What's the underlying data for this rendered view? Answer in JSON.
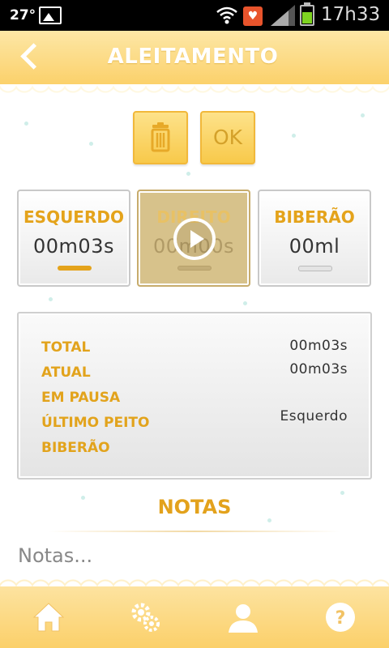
{
  "status_bar": {
    "temperature": "27°",
    "time": "17h33"
  },
  "header": {
    "title": "ALEITAMENTO"
  },
  "actions": {
    "ok_label": "OK"
  },
  "breasts": {
    "left": {
      "label": "ESQUERDO",
      "value": "00m03s"
    },
    "right": {
      "label": "DIREITO",
      "value": "00m00s"
    },
    "bottle": {
      "label": "BIBERÃO",
      "value": "00ml"
    }
  },
  "summary": {
    "rows": [
      {
        "label": "TOTAL",
        "value": "00m03s"
      },
      {
        "label": "ATUAL",
        "value": "00m03s"
      },
      {
        "label": "EM PAUSA",
        "value": ""
      },
      {
        "label": "ÚLTIMO PEITO",
        "value": "Esquerdo"
      },
      {
        "label": "BIBERÃO",
        "value": ""
      }
    ]
  },
  "notes": {
    "title": "NOTAS",
    "placeholder": "Notas..."
  },
  "colors": {
    "accent": "#e3a21c",
    "header": "#fbd16b"
  }
}
